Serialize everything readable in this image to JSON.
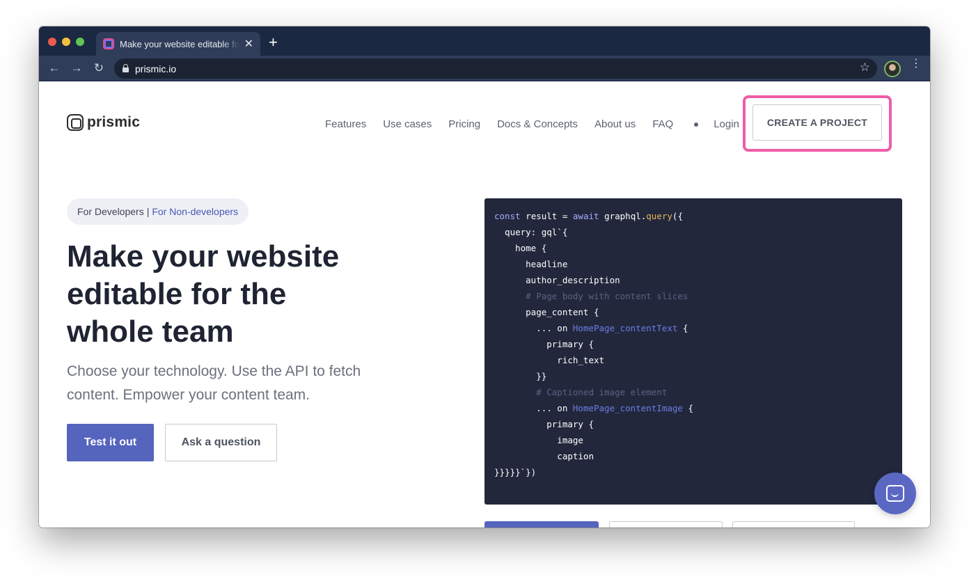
{
  "browser": {
    "tab_title": "Make your website editable for the whole team",
    "tab_close": "✕",
    "new_tab": "+",
    "back": "←",
    "forward": "→",
    "reload": "↻",
    "url": "prismic.io",
    "star": "☆",
    "menu": "⋮",
    "icons": {
      "favicon": "prismic-favicon-icon",
      "lock": "lock-icon",
      "bookmark": "star-icon",
      "profile": "avatar",
      "more": "kebab-menu-icon"
    }
  },
  "site": {
    "logo_text": "prismic",
    "nav": {
      "features": "Features",
      "use_cases": "Use cases",
      "pricing": "Pricing",
      "docs": "Docs & Concepts",
      "about": "About us",
      "faq": "FAQ",
      "login": "Login"
    },
    "cta": "CREATE A PROJECT",
    "highlight_color": "#ef5da8"
  },
  "hero": {
    "audience_dev": "For Developers",
    "audience_sep": "|",
    "audience_nondev": "For Non-developers",
    "title": "Make your website editable for the whole team",
    "subtitle": "Choose your technology. Use the API to fetch content. Empower your content team.",
    "primary_button": "Test it out",
    "secondary_button": "Ask a question",
    "accent_color": "#5564bd"
  },
  "code": {
    "lines": [
      [
        {
          "t": "const",
          "c": "kw"
        },
        {
          "t": " result = ",
          "c": ""
        },
        {
          "t": "await",
          "c": "kw"
        },
        {
          "t": " graphql.",
          "c": ""
        },
        {
          "t": "query",
          "c": "fn"
        },
        {
          "t": "({",
          "c": ""
        }
      ],
      [
        {
          "t": "  query: gql`{",
          "c": ""
        }
      ],
      [
        {
          "t": "    home {",
          "c": ""
        }
      ],
      [
        {
          "t": "      headline",
          "c": ""
        }
      ],
      [
        {
          "t": "      author_description",
          "c": ""
        }
      ],
      [
        {
          "t": "      # Page body with content slices",
          "c": "cm"
        }
      ],
      [
        {
          "t": "      page_content {",
          "c": ""
        }
      ],
      [
        {
          "t": "        ... on ",
          "c": ""
        },
        {
          "t": "HomePage_contentText",
          "c": "ty"
        },
        {
          "t": " {",
          "c": ""
        }
      ],
      [
        {
          "t": "          primary {",
          "c": ""
        }
      ],
      [
        {
          "t": "            rich_text",
          "c": ""
        }
      ],
      [
        {
          "t": "        }}",
          "c": ""
        }
      ],
      [
        {
          "t": "        # Captioned image element",
          "c": "cm"
        }
      ],
      [
        {
          "t": "        ... on ",
          "c": ""
        },
        {
          "t": "HomePage_contentImage",
          "c": "ty"
        },
        {
          "t": " {",
          "c": ""
        }
      ],
      [
        {
          "t": "          primary {",
          "c": ""
        }
      ],
      [
        {
          "t": "            image",
          "c": ""
        }
      ],
      [
        {
          "t": "            caption",
          "c": ""
        }
      ],
      [
        {
          "t": "}}}}}`})",
          "c": ""
        }
      ]
    ]
  },
  "chat": {
    "icon": "chat-bubble-icon"
  }
}
